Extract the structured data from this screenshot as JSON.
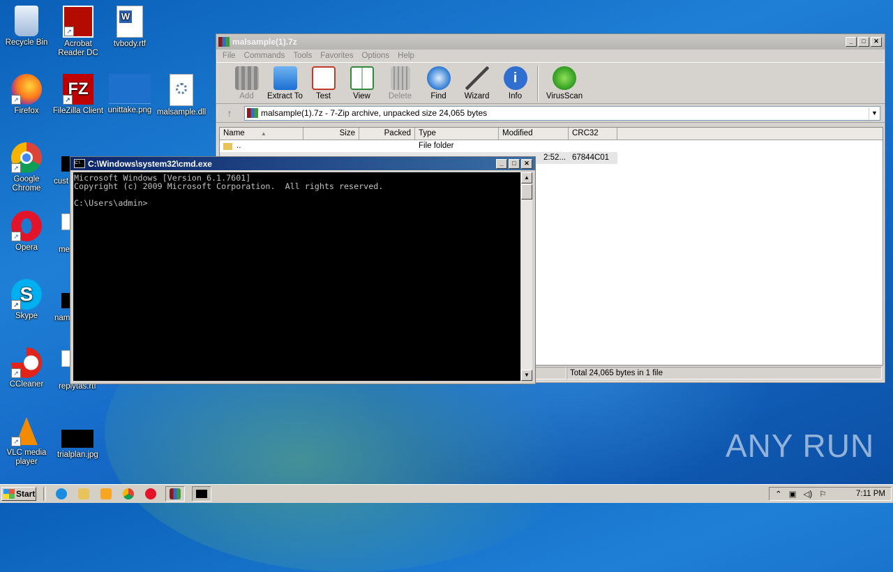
{
  "desktop": {
    "icons": [
      {
        "label": "Recycle Bin",
        "icon": "recycle-bin-icon"
      },
      {
        "label": "Acrobat Reader DC",
        "icon": "acrobat-icon"
      },
      {
        "label": "tvbody.rtf",
        "icon": "word-doc-icon"
      },
      {
        "label": "Firefox",
        "icon": "firefox-icon"
      },
      {
        "label": "FileZilla Client",
        "icon": "filezilla-icon"
      },
      {
        "label": "unittake.png",
        "icon": "image-file-icon"
      },
      {
        "label": "malsample.dll",
        "icon": "dll-file-icon"
      },
      {
        "label": "Google Chrome",
        "icon": "chrome-icon"
      },
      {
        "label": "cust",
        "icon": "black-thumbnail-icon"
      },
      {
        "label": "Opera",
        "icon": "opera-icon"
      },
      {
        "label": "me",
        "icon": "word-doc-icon"
      },
      {
        "label": "Skype",
        "icon": "skype-icon"
      },
      {
        "label": "nam",
        "icon": "black-thumbnail-icon"
      },
      {
        "label": "CCleaner",
        "icon": "ccleaner-icon"
      },
      {
        "label": "replytas.rtf",
        "icon": "word-doc-icon"
      },
      {
        "label": "VLC media player",
        "icon": "vlc-icon"
      },
      {
        "label": "trialplan.jpg",
        "icon": "black-thumbnail-icon"
      }
    ],
    "watermark": "ANY RUN"
  },
  "sevenzip": {
    "title": "malsample(1).7z",
    "menu": [
      "File",
      "Commands",
      "Tools",
      "Favorites",
      "Options",
      "Help"
    ],
    "toolbar": [
      {
        "label": "Add",
        "icon": "add-icon"
      },
      {
        "label": "Extract To",
        "icon": "extract-icon"
      },
      {
        "label": "Test",
        "icon": "test-icon"
      },
      {
        "label": "View",
        "icon": "view-icon"
      },
      {
        "label": "Delete",
        "icon": "delete-icon"
      },
      {
        "label": "Find",
        "icon": "find-icon"
      },
      {
        "label": "Wizard",
        "icon": "wizard-icon"
      },
      {
        "label": "Info",
        "icon": "info-icon"
      },
      {
        "label": "VirusScan",
        "icon": "virusscan-icon"
      }
    ],
    "address": "malsample(1).7z - 7-Zip archive, unpacked size 24,065 bytes",
    "columns": [
      "Name",
      "Size",
      "Packed",
      "Type",
      "Modified",
      "CRC32"
    ],
    "rows": [
      {
        "name": "..",
        "size": "",
        "packed": "",
        "type": "File folder",
        "modified": "",
        "crc": ""
      },
      {
        "name": "",
        "size": "",
        "packed": "",
        "type": "",
        "modified": "2:52...",
        "crc": "67844C01"
      }
    ],
    "status": "Total 24,065 bytes in 1 file"
  },
  "cmd": {
    "title": "C:\\Windows\\system32\\cmd.exe",
    "lines": "Microsoft Windows [Version 6.1.7601]\nCopyright (c) 2009 Microsoft Corporation.  All rights reserved.\n\nC:\\Users\\admin>"
  },
  "taskbar": {
    "start": "Start",
    "clock": "7:11 PM"
  },
  "colors": {
    "cmd_title": "#0a246a",
    "desktop_blue": "#1f7fd6"
  }
}
